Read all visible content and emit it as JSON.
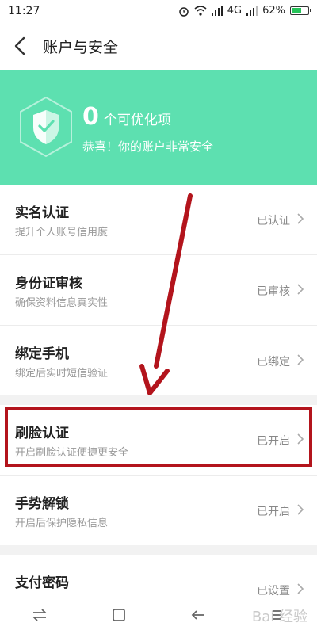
{
  "status_bar": {
    "time": "11:27",
    "network": "4G",
    "battery_percent": "62%",
    "battery_level": 0.62
  },
  "header": {
    "title": "账户与安全",
    "back_icon": "chevron-left-icon"
  },
  "banner": {
    "count": "0",
    "count_label": "个可优化项",
    "subtitle": "恭喜！你的账户非常安全",
    "icon": "shield-check-icon",
    "bg_color": "#5de0b0"
  },
  "items": [
    {
      "title": "实名认证",
      "subtitle": "提升个人账号信用度",
      "status": "已认证"
    },
    {
      "title": "身份证审核",
      "subtitle": "确保资料信息真实性",
      "status": "已审核"
    },
    {
      "title": "绑定手机",
      "subtitle": "绑定后实时短信验证",
      "status": "已绑定"
    },
    {
      "title": "刷脸认证",
      "subtitle": "开启刷脸认证便捷更安全",
      "status": "已开启"
    },
    {
      "title": "手势解锁",
      "subtitle": "开启后保护隐私信息",
      "status": "已开启"
    },
    {
      "title": "支付密码",
      "subtitle": "",
      "status": "已设置"
    }
  ],
  "annotation": {
    "highlight_color": "#b3141c",
    "highlighted_item": "刷脸认证"
  },
  "nav_bar": {
    "icons": [
      "swap-icon",
      "home-square-icon",
      "back-arrow-icon",
      "menu-icon"
    ]
  },
  "watermark": "Bai 经验"
}
